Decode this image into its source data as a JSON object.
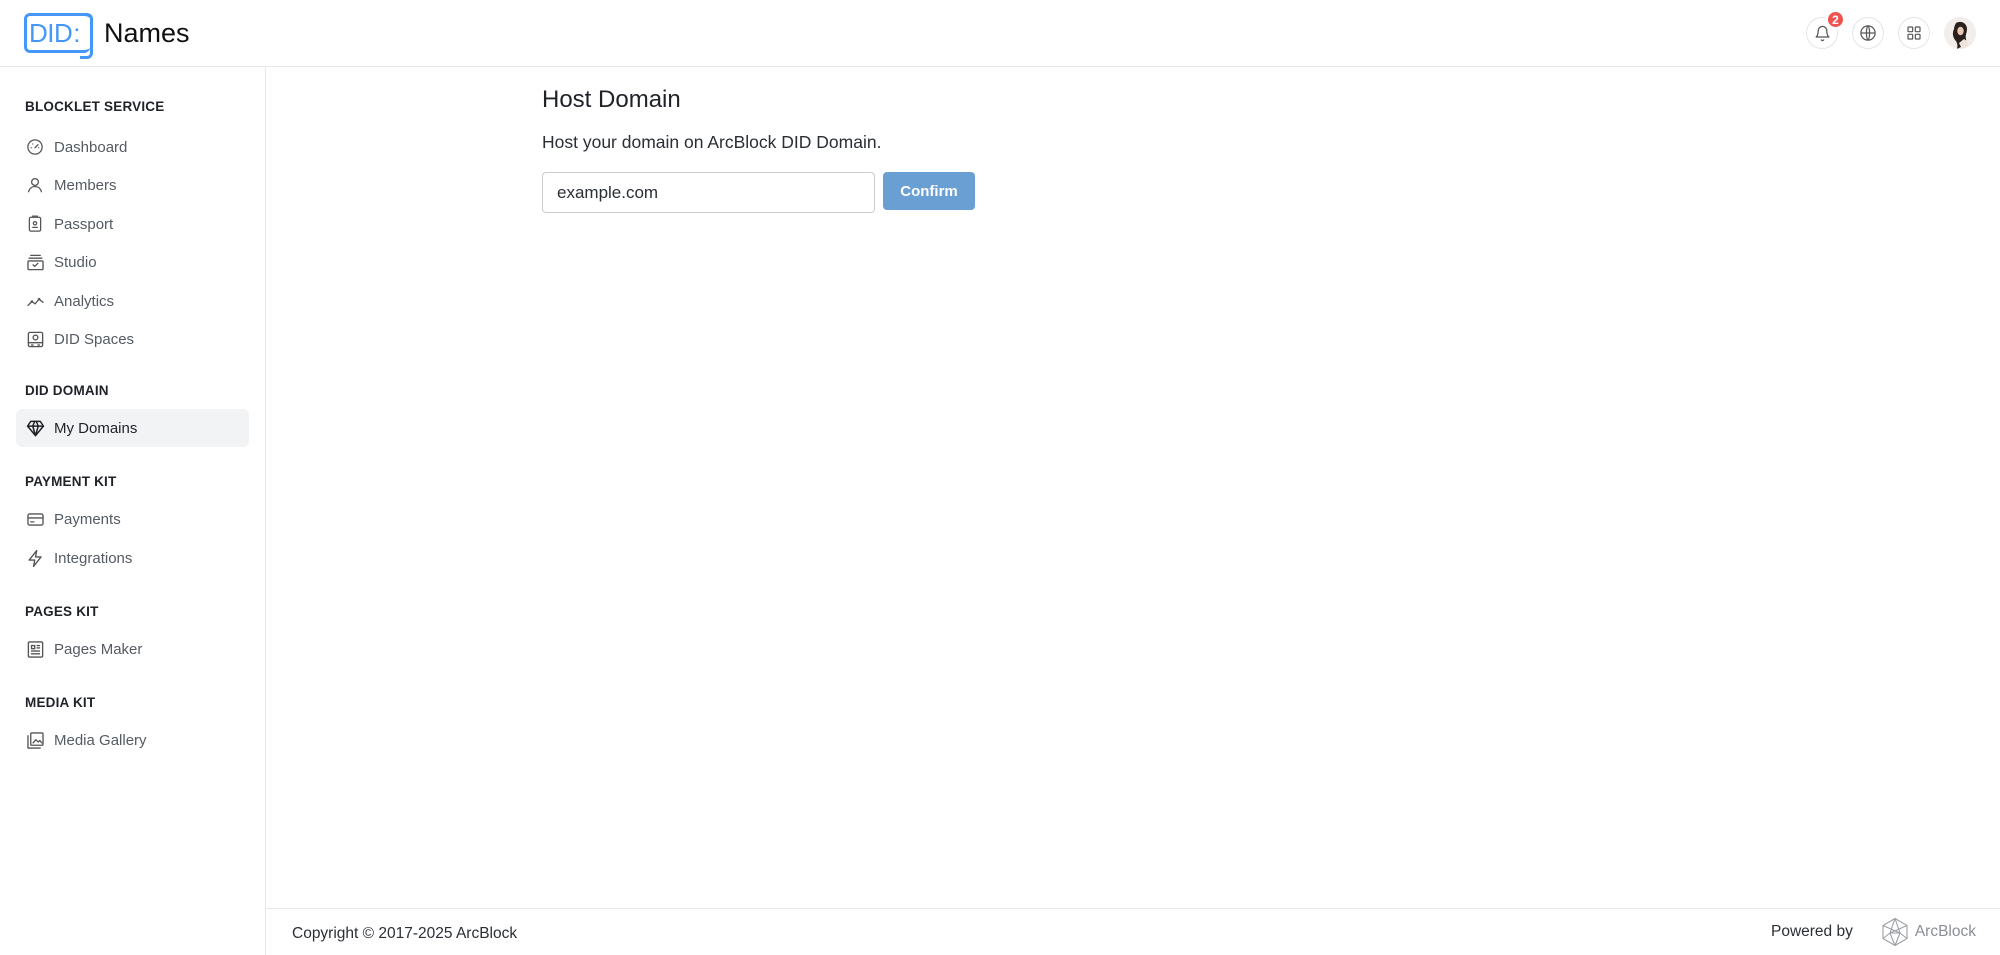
{
  "header": {
    "logo_text": "DID",
    "logo_colon": ":",
    "app_title": "Names",
    "notifications_count": "2",
    "icons": [
      "bell-icon",
      "globe-icon",
      "apps-icon",
      "avatar"
    ]
  },
  "sidebar": {
    "sections": [
      {
        "title": "BLOCKLET SERVICE",
        "items": [
          {
            "label": "Dashboard",
            "icon": "gauge-icon"
          },
          {
            "label": "Members",
            "icon": "user-icon"
          },
          {
            "label": "Passport",
            "icon": "passport-icon"
          },
          {
            "label": "Studio",
            "icon": "studio-icon"
          },
          {
            "label": "Analytics",
            "icon": "analytics-icon"
          },
          {
            "label": "DID Spaces",
            "icon": "spaces-icon"
          }
        ]
      },
      {
        "title": "DID DOMAIN",
        "items": [
          {
            "label": "My Domains",
            "icon": "diamond-icon",
            "active": true
          }
        ]
      },
      {
        "title": "PAYMENT KIT",
        "items": [
          {
            "label": "Payments",
            "icon": "card-icon"
          },
          {
            "label": "Integrations",
            "icon": "bolt-icon"
          }
        ]
      },
      {
        "title": "PAGES KIT",
        "items": [
          {
            "label": "Pages Maker",
            "icon": "pages-icon"
          }
        ]
      },
      {
        "title": "MEDIA KIT",
        "items": [
          {
            "label": "Media Gallery",
            "icon": "gallery-icon"
          }
        ]
      }
    ]
  },
  "main": {
    "title": "Host Domain",
    "description": "Host your domain on ArcBlock DID Domain.",
    "domain_input": {
      "value": "example.com",
      "placeholder": ""
    },
    "confirm_label": "Confirm"
  },
  "footer": {
    "copyright": "Copyright © 2017-2025  ArcBlock",
    "powered_by": "Powered by",
    "brand": "ArcBlock"
  },
  "colors": {
    "accent": "#4598fa",
    "confirm_button": "#6a9fd4",
    "badge": "#ef5350",
    "active_nav_bg": "#f2f3f5"
  }
}
